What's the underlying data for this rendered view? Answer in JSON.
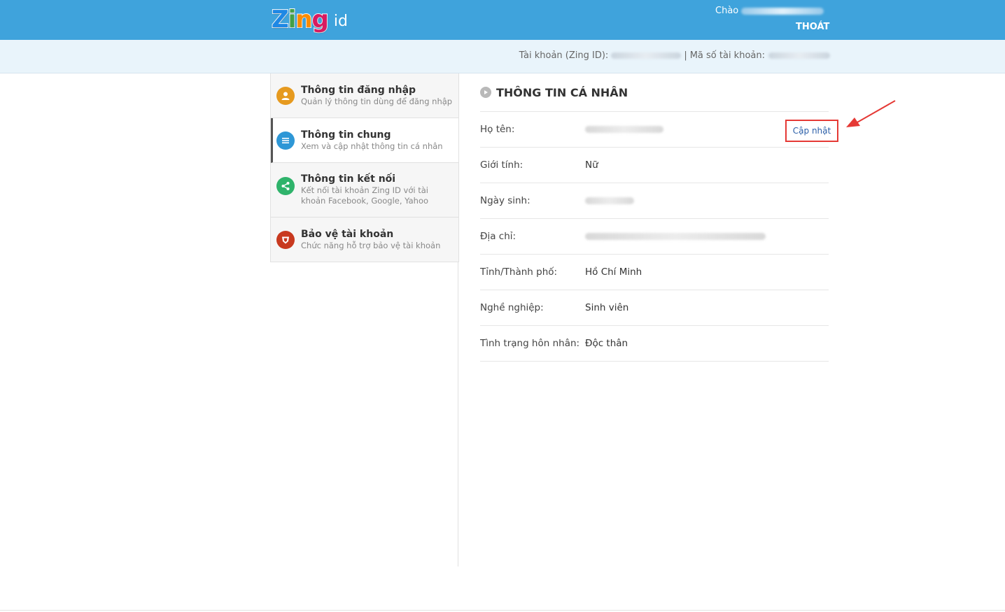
{
  "header": {
    "logo_word": "Zing",
    "logo_suffix": "id",
    "greeting": "Chào",
    "logout": "THOÁT"
  },
  "account_bar": {
    "zing_id_label": "Tài khoản (Zing ID):",
    "separator": "|",
    "account_no_label": "Mã số tài khoản:"
  },
  "sidebar": {
    "items": [
      {
        "title": "Thông tin đăng nhập",
        "desc": "Quản lý thông tin dùng để đăng nhập",
        "icon": "user-icon",
        "color": "#e69a1f"
      },
      {
        "title": "Thông tin chung",
        "desc": "Xem và cập nhật thông tin cá nhân",
        "icon": "list-icon",
        "color": "#2e97d6"
      },
      {
        "title": "Thông tin kết nối",
        "desc": "Kết nối tài khoản Zing ID với tài khoản Facebook, Google, Yahoo",
        "icon": "share-icon",
        "color": "#2fb36b"
      },
      {
        "title": "Bảo vệ tài khoản",
        "desc": "Chức năng hỗ trợ bảo vệ tài khoản",
        "icon": "shield-icon",
        "color": "#c8391f"
      }
    ]
  },
  "section": {
    "title": "THÔNG TIN CÁ NHÂN",
    "update_link": "Cập nhật",
    "rows": [
      {
        "label": "Họ tên:",
        "value": ""
      },
      {
        "label": "Giới tính:",
        "value": "Nữ"
      },
      {
        "label": "Ngày sinh:",
        "value": ""
      },
      {
        "label": "Địa chỉ:",
        "value": ""
      },
      {
        "label": "Tỉnh/Thành phố:",
        "value": "Hồ Chí Minh"
      },
      {
        "label": "Nghề nghiệp:",
        "value": "Sinh viên"
      },
      {
        "label": "Tình trạng hôn nhân:",
        "value": "Độc thân"
      }
    ]
  },
  "colors": {
    "header_bg": "#3fa3dc",
    "info_bar_bg": "#e9f4fb",
    "highlight_red": "#e53935",
    "link_blue": "#2b5fa8"
  }
}
